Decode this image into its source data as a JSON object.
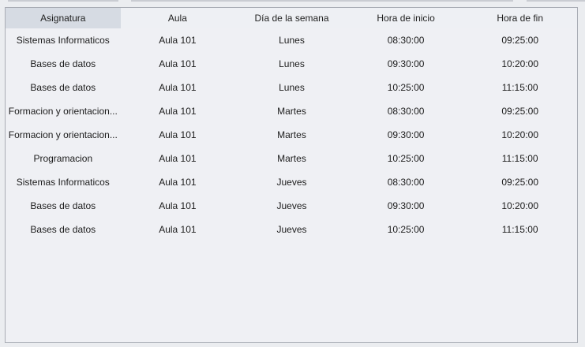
{
  "table": {
    "columns": [
      "Asignatura",
      "Aula",
      "Día de la semana",
      "Hora de inicio",
      "Hora de fin"
    ],
    "selected_column": 0,
    "rows": [
      [
        "Sistemas Informaticos",
        "Aula 101",
        "Lunes",
        "08:30:00",
        "09:25:00"
      ],
      [
        "Bases de datos",
        "Aula 101",
        "Lunes",
        "09:30:00",
        "10:20:00"
      ],
      [
        "Bases de datos",
        "Aula 101",
        "Lunes",
        "10:25:00",
        "11:15:00"
      ],
      [
        "Formacion y orientacion...",
        "Aula 101",
        "Martes",
        "08:30:00",
        "09:25:00"
      ],
      [
        "Formacion y orientacion...",
        "Aula 101",
        "Martes",
        "09:30:00",
        "10:20:00"
      ],
      [
        "Programacion",
        "Aula 101",
        "Martes",
        "10:25:00",
        "11:15:00"
      ],
      [
        "Sistemas Informaticos",
        "Aula 101",
        "Jueves",
        "08:30:00",
        "09:25:00"
      ],
      [
        "Bases de datos",
        "Aula 101",
        "Jueves",
        "09:30:00",
        "10:20:00"
      ],
      [
        "Bases de datos",
        "Aula 101",
        "Jueves",
        "10:25:00",
        "11:15:00"
      ]
    ]
  }
}
